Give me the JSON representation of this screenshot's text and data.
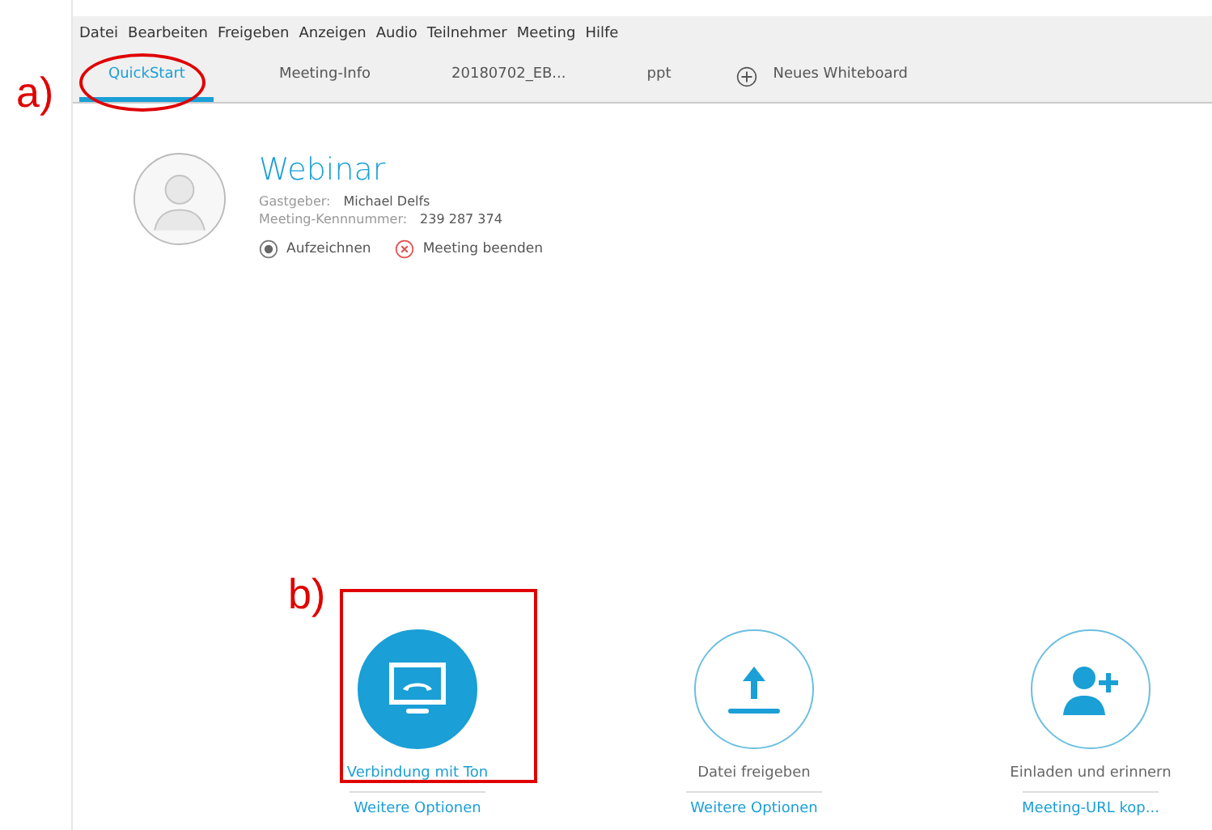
{
  "menu": [
    "Datei",
    "Bearbeiten",
    "Freigeben",
    "Anzeigen",
    "Audio",
    "Teilnehmer",
    "Meeting",
    "Hilfe"
  ],
  "tabs": [
    {
      "label": "QuickStart",
      "selected": true,
      "kind": "tab"
    },
    {
      "label": "Meeting-Info",
      "selected": false,
      "kind": "tab"
    },
    {
      "label": "20180702_EB...",
      "selected": false,
      "kind": "tab"
    },
    {
      "label": "ppt",
      "selected": false,
      "kind": "tab"
    },
    {
      "label": "Neues Whiteboard",
      "selected": false,
      "kind": "add"
    }
  ],
  "meeting": {
    "title": "Webinar",
    "host_label": "Gastgeber:",
    "host": "Michael Delfs",
    "number_label": "Meeting-Kennnummer:",
    "number": "239 287 374",
    "record": "Aufzeichnen",
    "end": "Meeting beenden"
  },
  "actions": [
    {
      "kind": "audio",
      "label": "Verbindung mit Ton",
      "link": "Weitere Optionen",
      "selected": true
    },
    {
      "kind": "upload",
      "label": "Datei freigeben",
      "link": "Weitere Optionen",
      "selected": false
    },
    {
      "kind": "invite",
      "label": "Einladen und erinnern",
      "link": "Meeting-URL kop...",
      "selected": false
    }
  ],
  "annotations": [
    {
      "label": "a)"
    },
    {
      "label": "b)"
    }
  ]
}
